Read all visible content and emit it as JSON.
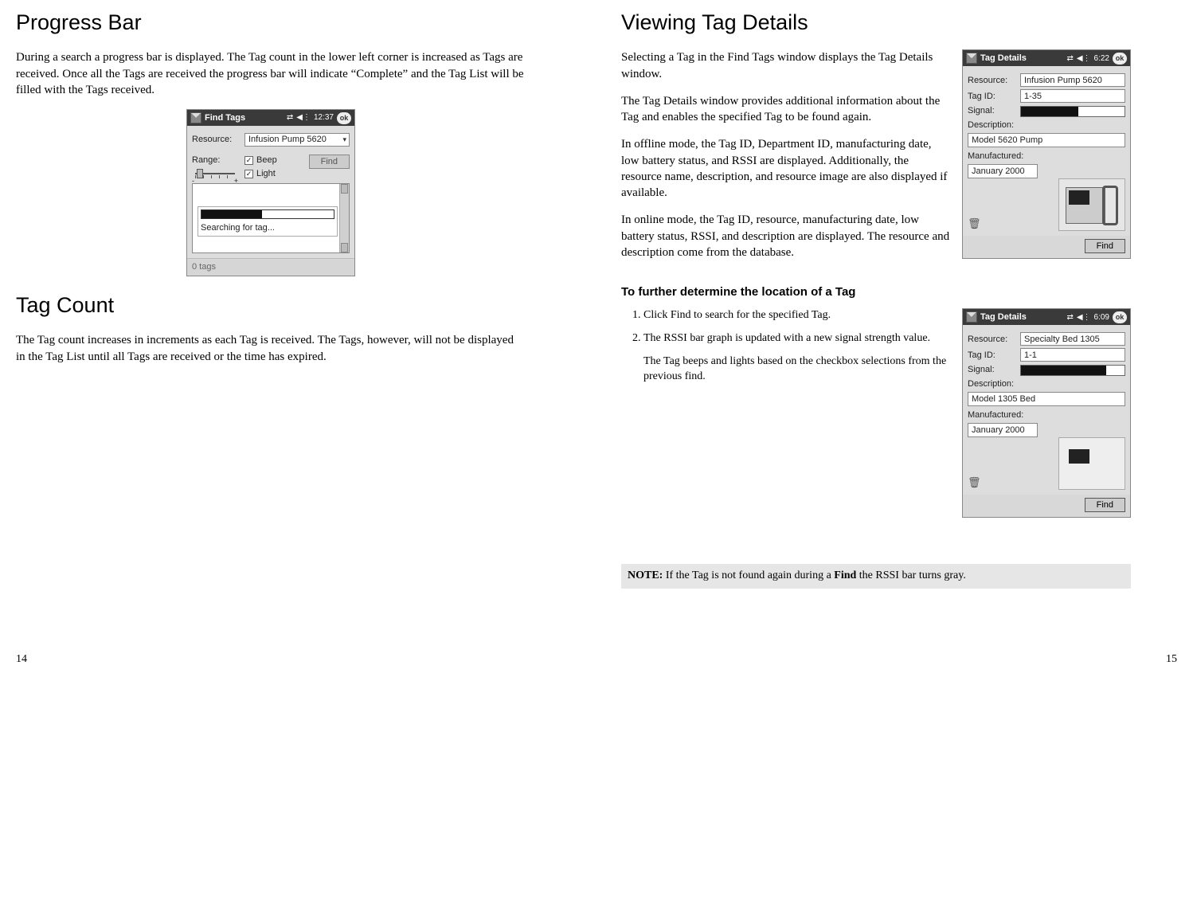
{
  "left": {
    "h_progress": "Progress Bar",
    "p_progress": "During a search a progress bar is displayed. The Tag count in the lower left corner is increased as Tags are received. Once all the Tags are received the progress bar will indicate “Complete” and the Tag List will be filled with the Tags received.",
    "h_tagcount": "Tag Count",
    "p_tagcount": "The Tag count increases in increments as each Tag is received. The Tags, however, will not be displayed in the Tag List until all Tags are received or the time has expired.",
    "page_num": "14"
  },
  "right": {
    "h_view": "Viewing Tag Details",
    "p1": "Selecting a Tag in the Find Tags window displays the Tag Details window.",
    "p2": "The Tag Details window provides additional information about the Tag and enables the specified Tag to be found again.",
    "p3": "In offline mode, the Tag ID, Department ID, manufacturing date, low battery status, and RSSI are displayed. Additionally, the resource name, description, and resource image are also displayed if available.",
    "p4": "In online mode, the Tag ID, resource, manufacturing date, low battery status, RSSI, and description are displayed. The resource and description come from the database.",
    "h_further": "To further determine the location of a Tag",
    "ol": {
      "i1": "Click Find to search for the specified Tag.",
      "i2": "The RSSI bar graph is updated with a new signal strength value.",
      "i2b": "The Tag beeps and lights based on the checkbox selections from the previous find."
    },
    "note_label": "NOTE:",
    "note_text": " If the Tag is not found again during a ",
    "note_bold": "Find",
    "note_tail": " the RSSI bar turns gray.",
    "page_num": "15"
  },
  "ppc_find": {
    "title": "Find Tags",
    "time": "12:37",
    "ok": "ok",
    "resource_lbl": "Resource:",
    "resource_val": "Infusion Pump 5620",
    "range_lbl": "Range:",
    "beep": "Beep",
    "light": "Light",
    "find_btn": "Find",
    "status": "Searching for tag...",
    "tagcount": "0 tags"
  },
  "ppc_det1": {
    "title": "Tag Details",
    "time": "6:22",
    "ok": "ok",
    "resource_lbl": "Resource:",
    "resource_val": "Infusion Pump 5620",
    "tagid_lbl": "Tag ID:",
    "tagid_val": "1-35",
    "signal_lbl": "Signal:",
    "desc_lbl": "Description:",
    "desc_val": "Model 5620 Pump",
    "mfg_lbl": "Manufactured:",
    "mfg_val": "January 2000",
    "find_btn": "Find"
  },
  "ppc_det2": {
    "title": "Tag Details",
    "time": "6:09",
    "ok": "ok",
    "resource_lbl": "Resource:",
    "resource_val": "Specialty Bed 1305",
    "tagid_lbl": "Tag ID:",
    "tagid_val": "1-1",
    "signal_lbl": "Signal:",
    "desc_lbl": "Description:",
    "desc_val": "Model 1305 Bed",
    "mfg_lbl": "Manufactured:",
    "mfg_val": "January 2000",
    "find_btn": "Find"
  }
}
